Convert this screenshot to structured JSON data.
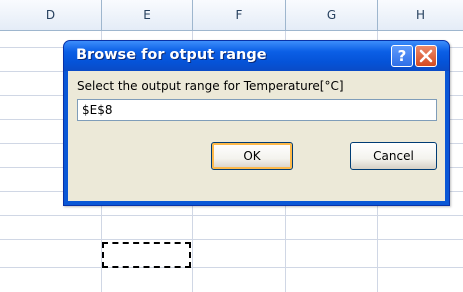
{
  "spreadsheet": {
    "columns": [
      "D",
      "E",
      "F",
      "G",
      "H"
    ]
  },
  "dialog": {
    "title": "Browse for otput range",
    "help_button": "?",
    "close_button": "×",
    "prompt": "Select the output range for Temperature[°C]",
    "range_value": "$E$8",
    "ok_label": "OK",
    "cancel_label": "Cancel"
  },
  "colors": {
    "titlebar": "#0553d8",
    "dialog_body": "#ece9d8",
    "close_button": "#d44a21",
    "grid_line": "#d0d7e5",
    "header_text": "#27415f"
  }
}
